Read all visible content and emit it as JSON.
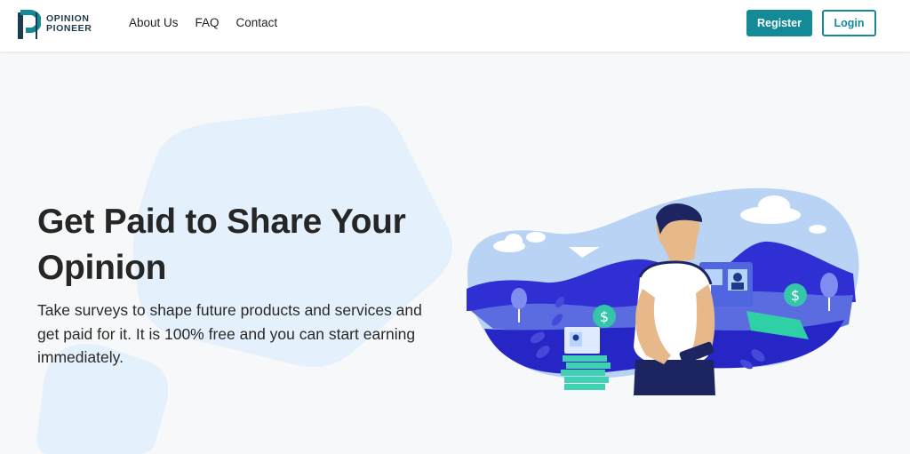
{
  "brand": {
    "line1": "OPINION",
    "line2": "PIONEER",
    "accent": "#138a96"
  },
  "nav": {
    "items": [
      {
        "label": "About Us"
      },
      {
        "label": "FAQ"
      },
      {
        "label": "Contact"
      }
    ]
  },
  "header": {
    "register_label": "Register",
    "login_label": "Login"
  },
  "hero": {
    "title": "Get Paid to Share Your Opinion",
    "subtitle": "Take surveys to shape future products and services and get paid for it. It is 100% free and you can start earning immediately."
  },
  "icons": {
    "logo": "opinion-pioneer-logo-mark",
    "illustration": "person-with-phone-surveys-money-illustration"
  }
}
